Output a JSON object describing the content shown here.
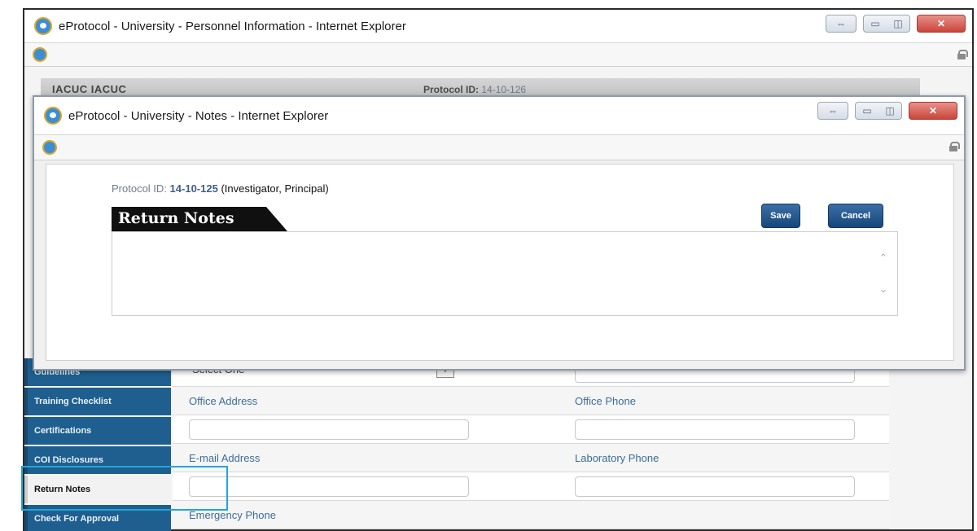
{
  "outer_window": {
    "title": "eProtocol - University - Personnel Information - Internet Explorer",
    "header": {
      "app_name": "IACUC  IACUC",
      "protocol_label": "Protocol ID:",
      "protocol_value": "14-10-126"
    }
  },
  "inner_window": {
    "title": "eProtocol - University - Notes - Internet Explorer",
    "protocol_label": "Protocol ID:",
    "protocol_value": "14-10-125",
    "protocol_role": "(Investigator, Principal)",
    "section_title": "Return Notes",
    "save_label": "Save",
    "cancel_label": "Cancel",
    "notes_value": ""
  },
  "sidebar": {
    "items": [
      {
        "label": "Guidelines"
      },
      {
        "label": "Training Checklist"
      },
      {
        "label": "Certifications"
      },
      {
        "label": "COI Disclosures"
      },
      {
        "label": "Return Notes"
      },
      {
        "label": "Check For Approval"
      }
    ]
  },
  "form": {
    "select_value": "Select One",
    "office_address_label": "Office Address",
    "office_phone_label": "Office Phone",
    "email_label": "E-mail Address",
    "lab_phone_label": "Laboratory Phone",
    "emergency_phone_label": "Emergency Phone"
  },
  "colors": {
    "sidebar_bg": "#1f5f8f",
    "highlight": "#22a6d9",
    "button": "#17477a",
    "label": "#3d6d9a"
  }
}
